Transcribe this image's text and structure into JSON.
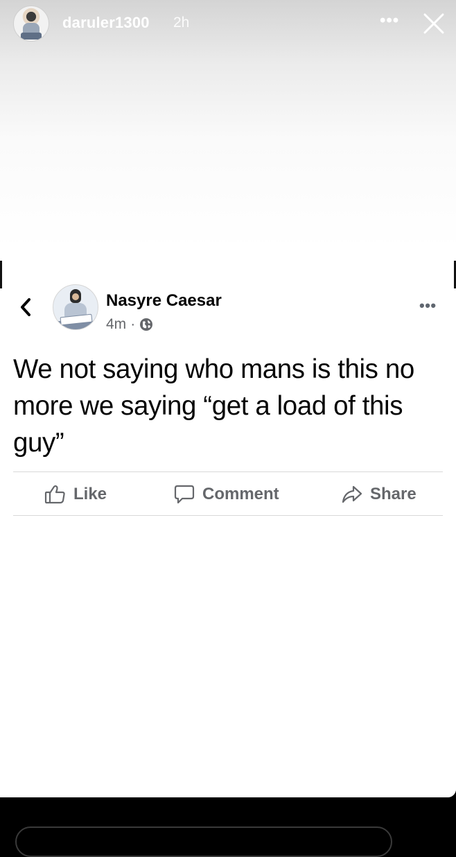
{
  "story": {
    "username": "daruler1300",
    "time": "2h",
    "more": "•••",
    "close_icon": "close-icon"
  },
  "post": {
    "author": "Nasyre Caesar",
    "time": "4m",
    "separator": "·",
    "privacy_icon": "globe-icon",
    "more": "•••",
    "text": "We not saying who mans is this no more we saying “get a load of this guy”",
    "actions": {
      "like": "Like",
      "comment": "Comment",
      "share": "Share"
    }
  },
  "colors": {
    "story_header_text": "#ffffff",
    "post_text": "#050505",
    "meta_text": "#65676b",
    "divider": "#d8d8d8"
  }
}
